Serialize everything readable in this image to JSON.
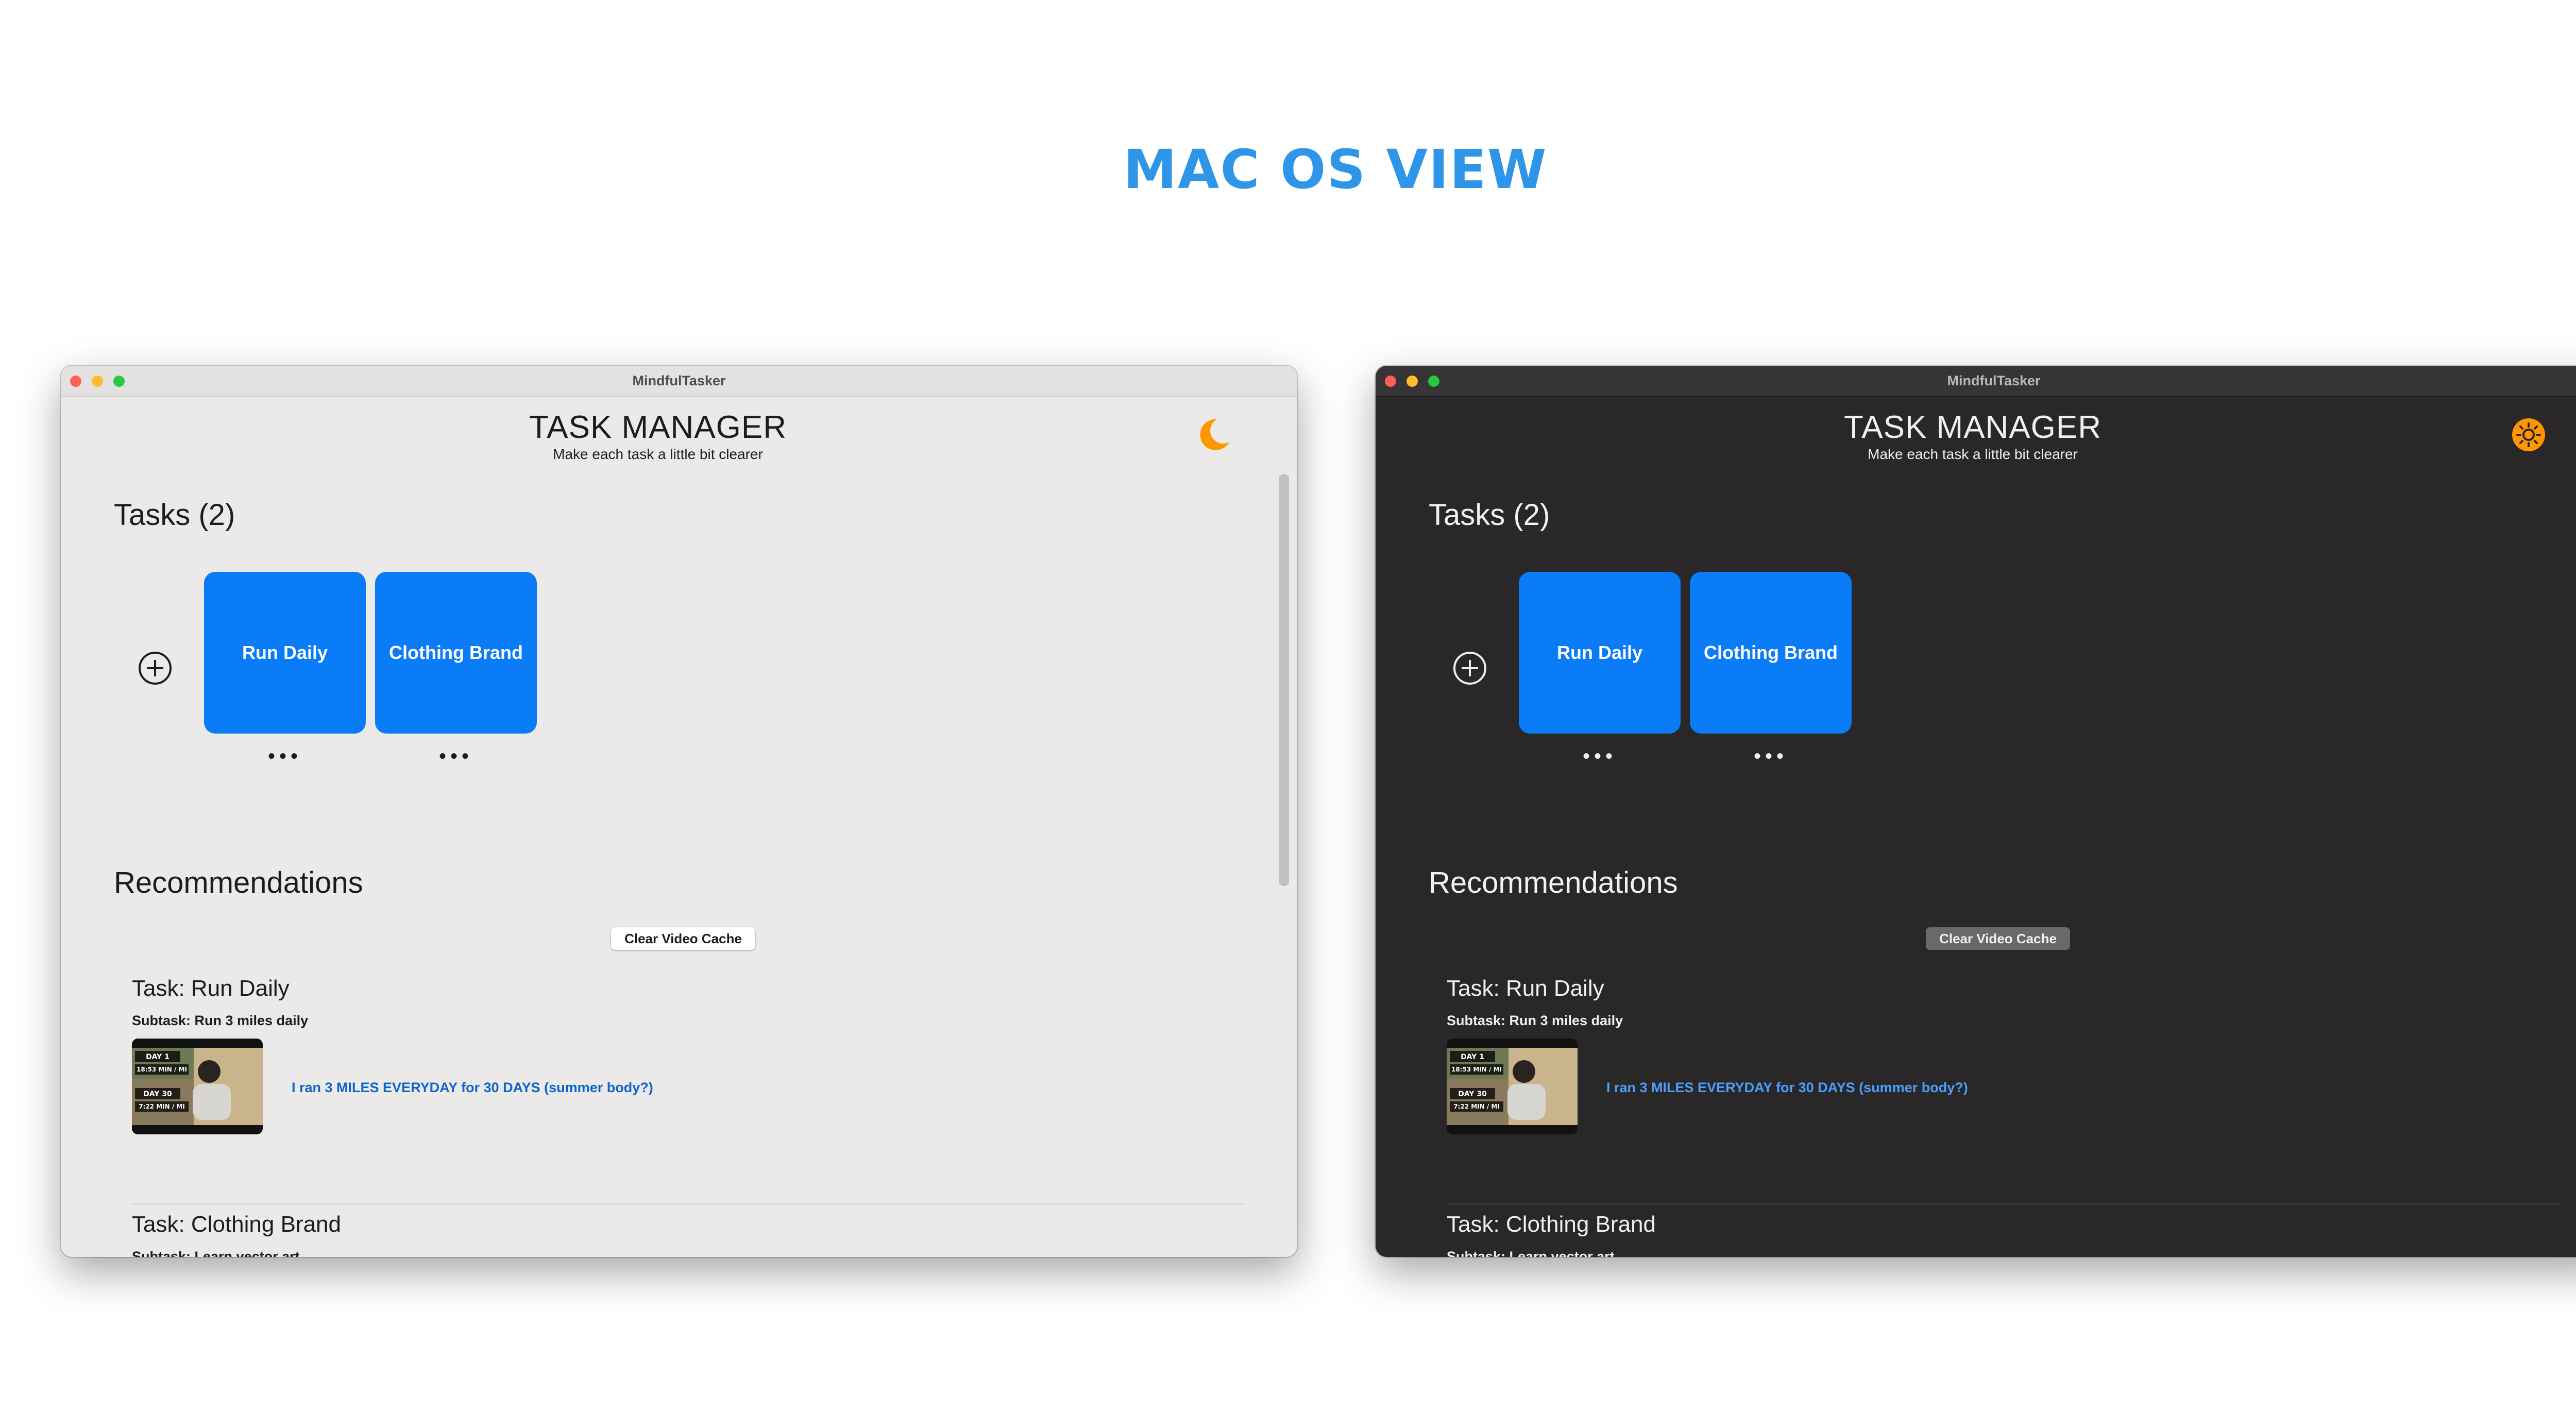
{
  "page_heading": "mac os view",
  "windows": [
    {
      "theme": "light",
      "window_title": "MindfulTasker",
      "app_title": "TASK MANAGER",
      "app_subtitle": "Make each task a little bit clearer",
      "theme_toggle_icon": "moon-icon",
      "tasks_header": "Tasks (2)",
      "tasks": [
        {
          "label": "Run Daily",
          "more": "•••"
        },
        {
          "label": "Clothing Brand",
          "more": "•••"
        }
      ],
      "recommendations_header": "Recommendations",
      "clear_cache_label": "Clear Video Cache",
      "recommendations": [
        {
          "task": "Task: Run Daily",
          "subtask": "Subtask: Run 3 miles daily",
          "video_title": "I ran 3 MILES EVERYDAY for 30 DAYS (summer body?)"
        },
        {
          "task": "Task: Clothing Brand",
          "subtask": "Subtask: Learn vector art"
        }
      ],
      "thumbnail_text": {
        "line1": "DAY 1",
        "line2": "18:53 MIN / MI",
        "line3": "DAY 30",
        "line4": "7:22 MIN / MI"
      }
    },
    {
      "theme": "dark",
      "window_title": "MindfulTasker",
      "app_title": "TASK MANAGER",
      "app_subtitle": "Make each task a little bit clearer",
      "theme_toggle_icon": "sun-icon",
      "tasks_header": "Tasks (2)",
      "tasks": [
        {
          "label": "Run Daily",
          "more": "•••"
        },
        {
          "label": "Clothing Brand",
          "more": "•••"
        }
      ],
      "recommendations_header": "Recommendations",
      "clear_cache_label": "Clear Video Cache",
      "recommendations": [
        {
          "task": "Task: Run Daily",
          "subtask": "Subtask: Run 3 miles daily",
          "video_title": "I ran 3 MILES EVERYDAY for 30 DAYS (summer body?)"
        },
        {
          "task": "Task: Clothing Brand",
          "subtask": "Subtask: Learn vector art"
        }
      ],
      "thumbnail_text": {
        "line1": "DAY 1",
        "line2": "18:53 MIN / MI",
        "line3": "DAY 30",
        "line4": "7:22 MIN / MI"
      }
    }
  ],
  "colors": {
    "heading": "#2f95e8",
    "task_card": "#0a7cf8",
    "toggle_accent": "#ff9500",
    "light_background": "#eceae8",
    "dark_background": "#292727"
  }
}
